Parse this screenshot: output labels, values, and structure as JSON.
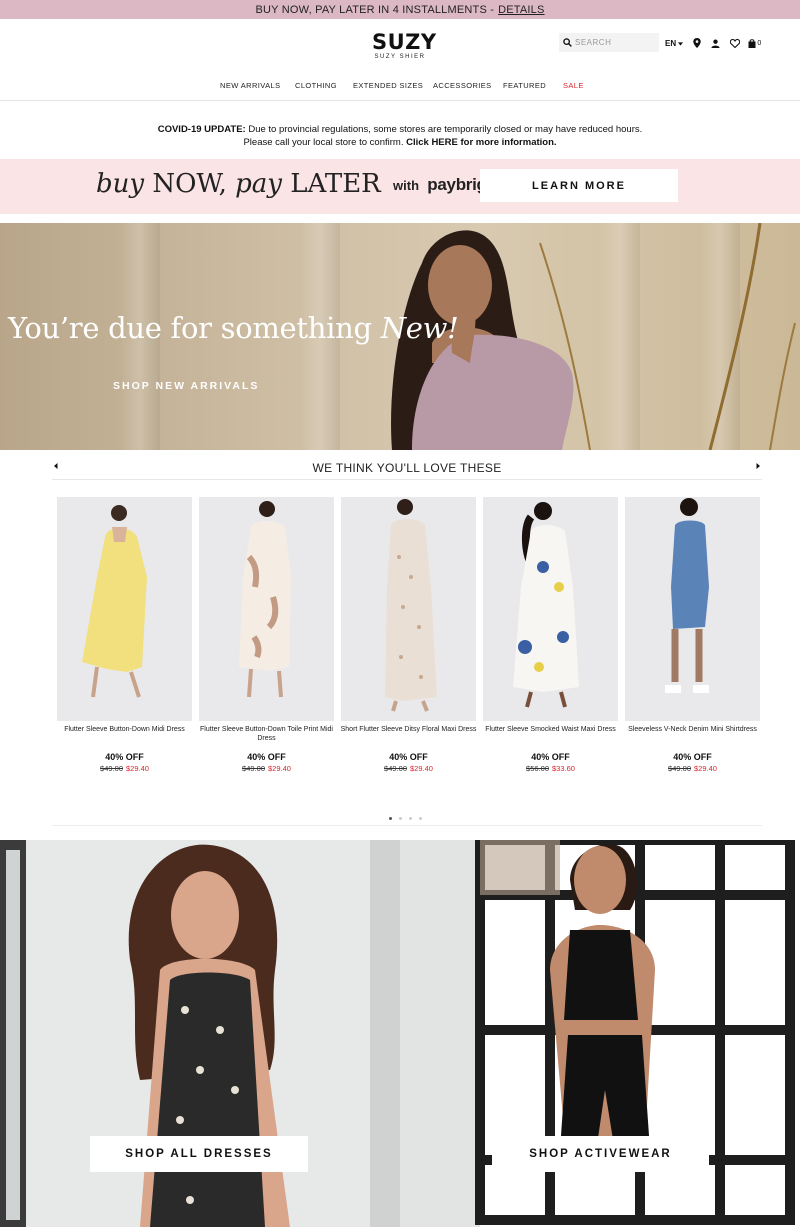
{
  "promo": {
    "text": "BUY NOW, PAY LATER IN 4 INSTALLMENTS -",
    "link": "DETAILS"
  },
  "header": {
    "logo_main": "SUZY",
    "logo_sub": "SUZY SHIER",
    "search_placeholder": "SEARCH",
    "language": "EN",
    "cart_count": "0"
  },
  "nav": {
    "items": [
      "NEW ARRIVALS",
      "CLOTHING",
      "EXTENDED SIZES",
      "ACCESSORIES",
      "FEATURED",
      "SALE"
    ]
  },
  "covid": {
    "label": "COVID-19 UPDATE:",
    "line1": " Due to provincial regulations, some stores are temporarily closed or may have reduced hours.",
    "line2": "Please call your local store to confirm. ",
    "link": "Click HERE for more information."
  },
  "paybright": {
    "buy": "buy",
    "now": "NOW,",
    "pay": "pay",
    "later": "LATER",
    "with": "with",
    "brand": "paybright",
    "button": "LEARN MORE"
  },
  "hero": {
    "title_start": "You’re due for something ",
    "title_em": "New!",
    "cta": "SHOP NEW ARRIVALS"
  },
  "carousel": {
    "title": "WE THINK YOU'LL LOVE THESE",
    "products": [
      {
        "name": "Flutter Sleeve Button-Down Midi Dress",
        "discount": "40% OFF",
        "original": "$49.00",
        "sale": "$29.40"
      },
      {
        "name": "Flutter Sleeve Button-Down Toile Print Midi Dress",
        "discount": "40% OFF",
        "original": "$49.00",
        "sale": "$29.40"
      },
      {
        "name": "Short Flutter Sleeve Ditsy Floral Maxi Dress",
        "discount": "40% OFF",
        "original": "$49.00",
        "sale": "$29.40"
      },
      {
        "name": "Flutter Sleeve Smocked Waist Maxi Dress",
        "discount": "40% OFF",
        "original": "$56.00",
        "sale": "$33.60"
      },
      {
        "name": "Sleeveless V-Neck Denim Mini Shirtdress",
        "discount": "40% OFF",
        "original": "$49.00",
        "sale": "$29.40"
      }
    ]
  },
  "promos": {
    "dresses_button": "SHOP ALL DRESSES",
    "active_button": "SHOP ACTIVEWEAR"
  },
  "colors": {
    "promo_bar": "#dcb8c4",
    "sale_red": "#d9242c",
    "paybright_bg": "#fbe4e6"
  }
}
